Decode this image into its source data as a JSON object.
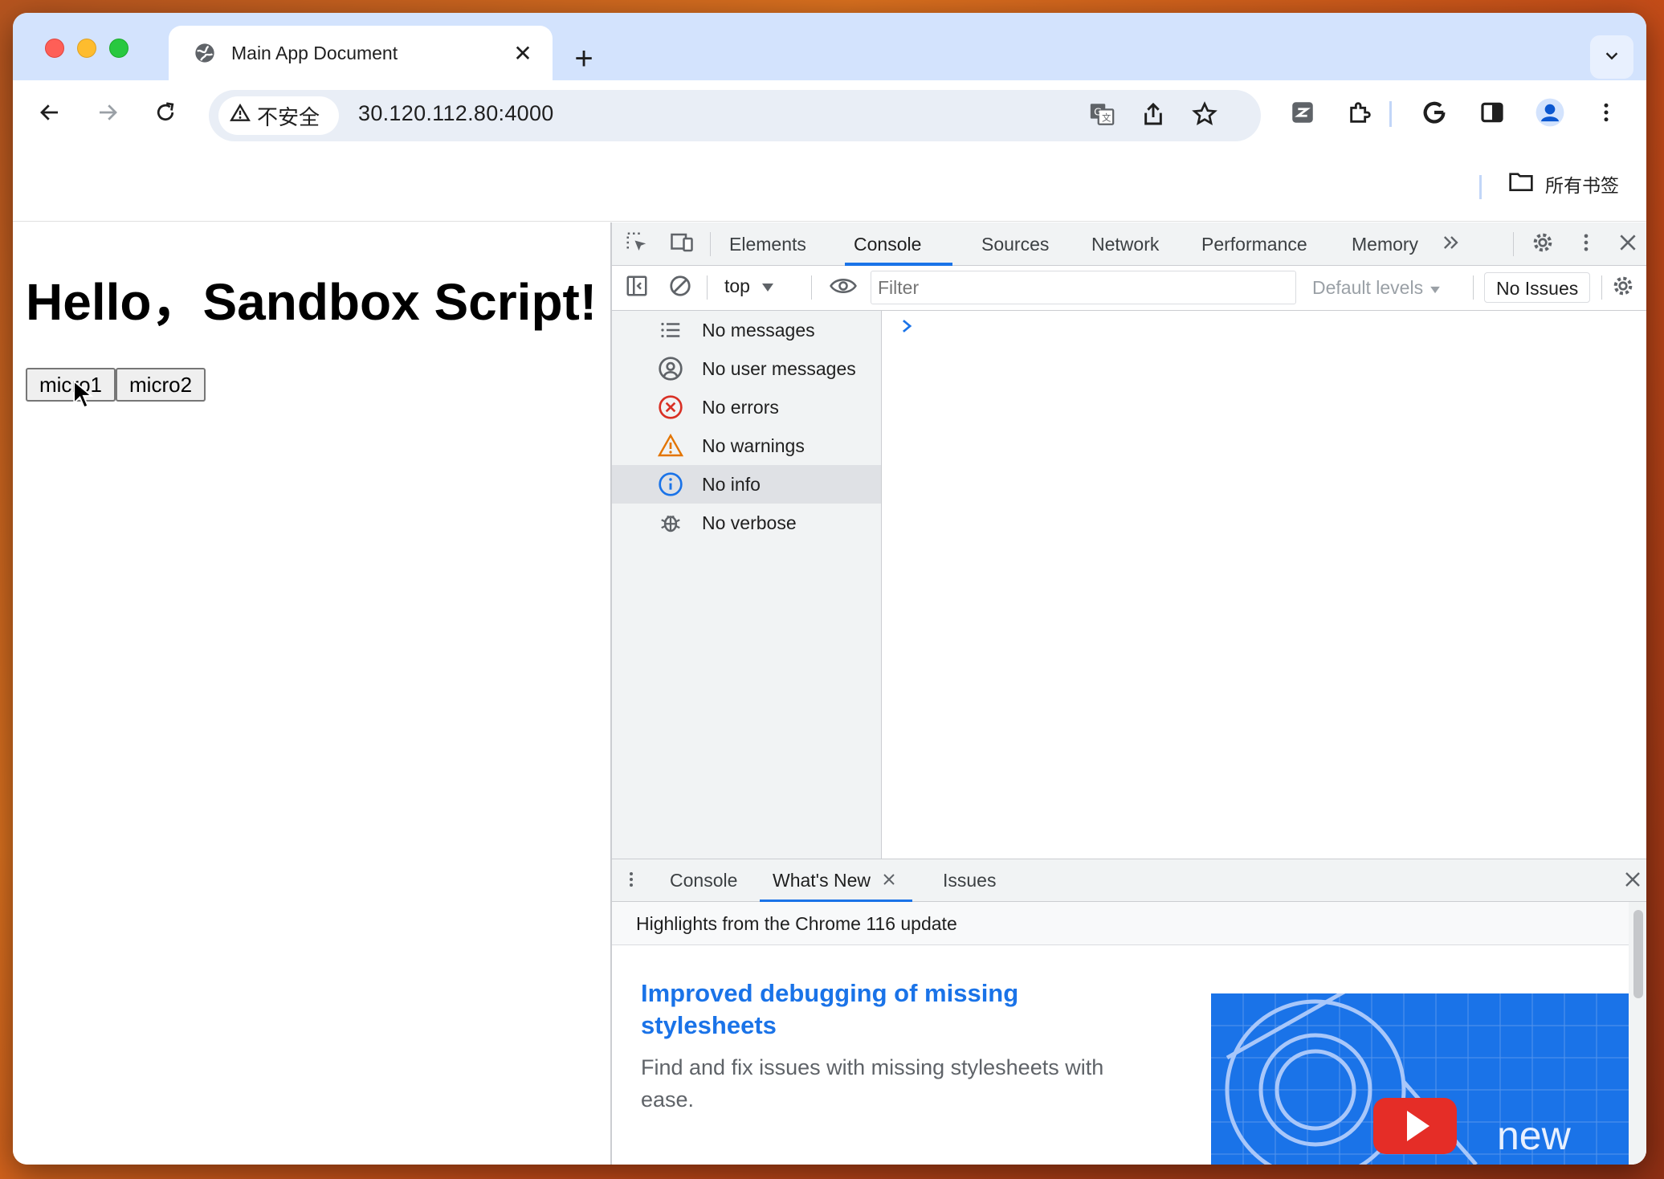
{
  "browser": {
    "tab": {
      "title": "Main App Document",
      "close_glyph": "✕"
    },
    "new_tab_glyph": "+",
    "omnibox": {
      "security_label": "不安全",
      "url": "30.120.112.80:4000"
    },
    "bookmarks": {
      "folder_label": "所有书签"
    }
  },
  "page": {
    "heading": "Hello，Sandbox Script!",
    "buttons": [
      "micro1",
      "micro2"
    ]
  },
  "devtools": {
    "tabs": [
      "Elements",
      "Console",
      "Sources",
      "Network",
      "Performance",
      "Memory"
    ],
    "active_tab": "Console",
    "context": "top",
    "filter_placeholder": "Filter",
    "levels_label": "Default levels",
    "issues_label": "No Issues",
    "sidebar": [
      {
        "label": "No messages",
        "icon": "list-icon"
      },
      {
        "label": "No user messages",
        "icon": "user-circle-icon"
      },
      {
        "label": "No errors",
        "icon": "error-icon"
      },
      {
        "label": "No warnings",
        "icon": "warning-icon"
      },
      {
        "label": "No info",
        "icon": "info-icon",
        "selected": true
      },
      {
        "label": "No verbose",
        "icon": "bug-icon"
      }
    ],
    "drawer": {
      "tabs": [
        "Console",
        "What's New",
        "Issues"
      ],
      "active_tab": "What's New",
      "header": "Highlights from the Chrome 116 update",
      "article_title": "Improved debugging of missing stylesheets",
      "article_desc": "Find and fix issues with missing stylesheets with ease.",
      "image_badge": "new"
    }
  },
  "colors": {
    "accent": "#1a73e8",
    "tabstrip": "#d3e3fd",
    "error": "#d93025",
    "warning": "#e37400"
  }
}
